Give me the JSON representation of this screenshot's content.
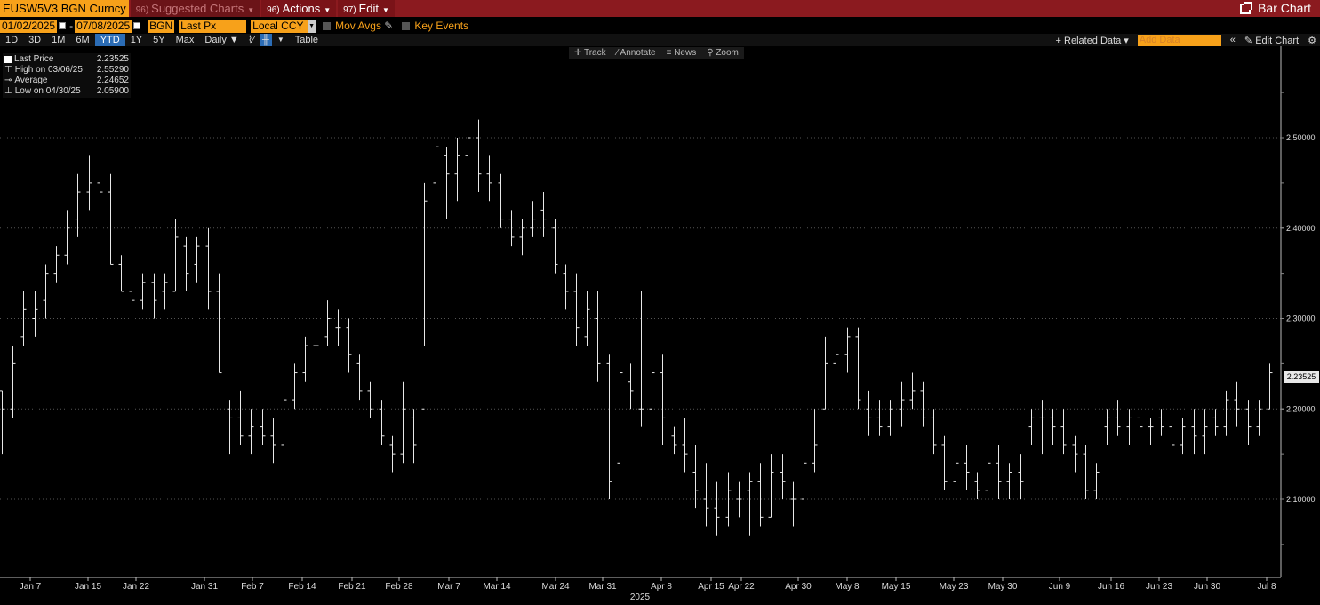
{
  "toolbar": {
    "ticker": "EUSW5V3 BGN Curncy",
    "menus": [
      {
        "num": "96)",
        "label": "Suggested Charts",
        "dim": true
      },
      {
        "num": "96)",
        "label": "Actions",
        "dim": false
      },
      {
        "num": "97)",
        "label": "Edit",
        "dim": false
      }
    ],
    "right_label": "Bar Chart"
  },
  "controls": {
    "start_date": "01/02/2025",
    "end_date": "07/08/2025",
    "source": "BGN",
    "field": "Last Px",
    "currency": "Local CCY",
    "mov_avgs": "Mov Avgs",
    "key_events": "Key Events"
  },
  "periods": [
    "1D",
    "3D",
    "1M",
    "6M",
    "YTD",
    "1Y",
    "5Y",
    "Max"
  ],
  "active_period": "YTD",
  "frequency": "Daily ▼",
  "table_label": "Table",
  "related_data": "+ Related Data ▾",
  "add_data_placeholder": "Add Data",
  "edit_chart": "Edit Chart",
  "chart_tools": [
    "Track",
    "Annotate",
    "News",
    "Zoom"
  ],
  "legend": [
    {
      "label": "Last Price",
      "value": "2.23525"
    },
    {
      "label": "High on 03/06/25",
      "value": "2.55290"
    },
    {
      "label": "Average",
      "value": "2.24652"
    },
    {
      "label": "Low on 04/30/25",
      "value": "2.05900"
    }
  ],
  "last_price_tag": "2.23525",
  "chart_data": {
    "type": "bar",
    "ylim": [
      2.0,
      2.56
    ],
    "y_ticks": [
      2.1,
      2.2,
      2.3,
      2.4,
      2.5
    ],
    "y_tick_labels": [
      "2.10000",
      "2.20000",
      "2.30000",
      "2.40000",
      "2.50000"
    ],
    "x_tick_labels": [
      "Jan 7",
      "Jan 15",
      "Jan 22",
      "Jan 31",
      "Feb 7",
      "Feb 14",
      "Feb 21",
      "Feb 28",
      "Mar 7",
      "Mar 14",
      "Mar 24",
      "Mar 31",
      "Apr 8",
      "Apr 15",
      "Apr 22",
      "Apr 30",
      "May 8",
      "May 15",
      "May 23",
      "May 30",
      "Jun 9",
      "Jun 16",
      "Jun 23",
      "Jun 30",
      "Jul 8"
    ],
    "year_label": "2025",
    "ohlc": [
      [
        2.22,
        2.22,
        2.15,
        2.2
      ],
      [
        2.2,
        2.27,
        2.19,
        2.25
      ],
      [
        2.28,
        2.33,
        2.27,
        2.31
      ],
      [
        2.3,
        2.33,
        2.28,
        2.31
      ],
      [
        2.32,
        2.36,
        2.3,
        2.35
      ],
      [
        2.35,
        2.38,
        2.34,
        2.37
      ],
      [
        2.37,
        2.42,
        2.36,
        2.4
      ],
      [
        2.41,
        2.46,
        2.39,
        2.44
      ],
      [
        2.44,
        2.48,
        2.42,
        2.45
      ],
      [
        2.45,
        2.47,
        2.41,
        2.44
      ],
      [
        2.44,
        2.46,
        2.36,
        2.36
      ],
      [
        2.36,
        2.37,
        2.33,
        2.33
      ],
      [
        2.33,
        2.34,
        2.31,
        2.32
      ],
      [
        2.32,
        2.35,
        2.31,
        2.34
      ],
      [
        2.34,
        2.35,
        2.3,
        2.32
      ],
      [
        2.33,
        2.35,
        2.31,
        2.34
      ],
      [
        2.33,
        2.41,
        2.33,
        2.39
      ],
      [
        2.38,
        2.39,
        2.33,
        2.35
      ],
      [
        2.36,
        2.39,
        2.34,
        2.38
      ],
      [
        2.38,
        2.4,
        2.31,
        2.33
      ],
      [
        2.33,
        2.35,
        2.24,
        2.24
      ],
      [
        2.2,
        2.21,
        2.15,
        2.19
      ],
      [
        2.19,
        2.22,
        2.16,
        2.17
      ],
      [
        2.17,
        2.2,
        2.15,
        2.18
      ],
      [
        2.18,
        2.2,
        2.16,
        2.17
      ],
      [
        2.17,
        2.19,
        2.14,
        2.16
      ],
      [
        2.16,
        2.22,
        2.16,
        2.21
      ],
      [
        2.21,
        2.25,
        2.2,
        2.24
      ],
      [
        2.24,
        2.28,
        2.23,
        2.27
      ],
      [
        2.27,
        2.29,
        2.26,
        2.27
      ],
      [
        2.28,
        2.32,
        2.27,
        2.3
      ],
      [
        2.29,
        2.31,
        2.27,
        2.29
      ],
      [
        2.29,
        2.3,
        2.24,
        2.26
      ],
      [
        2.25,
        2.26,
        2.21,
        2.22
      ],
      [
        2.22,
        2.23,
        2.19,
        2.2
      ],
      [
        2.2,
        2.21,
        2.16,
        2.17
      ],
      [
        2.16,
        2.17,
        2.13,
        2.15
      ],
      [
        2.15,
        2.23,
        2.14,
        2.2
      ],
      [
        2.19,
        2.2,
        2.14,
        2.16
      ],
      [
        2.2,
        2.45,
        2.27,
        2.43
      ],
      [
        2.45,
        2.55,
        2.42,
        2.49
      ],
      [
        2.48,
        2.49,
        2.41,
        2.46
      ],
      [
        2.46,
        2.5,
        2.43,
        2.48
      ],
      [
        2.48,
        2.52,
        2.47,
        2.5
      ],
      [
        2.5,
        2.52,
        2.44,
        2.46
      ],
      [
        2.46,
        2.48,
        2.43,
        2.45
      ],
      [
        2.45,
        2.46,
        2.4,
        2.41
      ],
      [
        2.41,
        2.42,
        2.38,
        2.39
      ],
      [
        2.39,
        2.41,
        2.37,
        2.4
      ],
      [
        2.4,
        2.43,
        2.39,
        2.41
      ],
      [
        2.42,
        2.44,
        2.39,
        2.41
      ],
      [
        2.4,
        2.41,
        2.35,
        2.36
      ],
      [
        2.35,
        2.36,
        2.31,
        2.33
      ],
      [
        2.33,
        2.35,
        2.27,
        2.29
      ],
      [
        2.28,
        2.33,
        2.27,
        2.31
      ],
      [
        2.3,
        2.33,
        2.23,
        2.25
      ],
      [
        2.25,
        2.26,
        2.1,
        2.12
      ],
      [
        2.14,
        2.3,
        2.12,
        2.24
      ],
      [
        2.23,
        2.25,
        2.2,
        2.22
      ],
      [
        2.2,
        2.33,
        2.18,
        2.2
      ],
      [
        2.2,
        2.26,
        2.17,
        2.24
      ],
      [
        2.24,
        2.26,
        2.16,
        2.19
      ],
      [
        2.17,
        2.18,
        2.15,
        2.16
      ],
      [
        2.16,
        2.19,
        2.13,
        2.15
      ],
      [
        2.13,
        2.16,
        2.09,
        2.11
      ],
      [
        2.1,
        2.14,
        2.07,
        2.09
      ],
      [
        2.09,
        2.12,
        2.06,
        2.08
      ],
      [
        2.08,
        2.13,
        2.07,
        2.11
      ],
      [
        2.1,
        2.12,
        2.08,
        2.1
      ],
      [
        2.11,
        2.13,
        2.06,
        2.12
      ],
      [
        2.12,
        2.14,
        2.07,
        2.08
      ],
      [
        2.08,
        2.15,
        2.08,
        2.13
      ],
      [
        2.13,
        2.15,
        2.1,
        2.12
      ],
      [
        2.1,
        2.12,
        2.07,
        2.1
      ],
      [
        2.1,
        2.15,
        2.08,
        2.14
      ],
      [
        2.14,
        2.2,
        2.13,
        2.16
      ],
      [
        2.2,
        2.28,
        2.2,
        2.25
      ],
      [
        2.25,
        2.27,
        2.24,
        2.26
      ],
      [
        2.26,
        2.29,
        2.24,
        2.28
      ],
      [
        2.28,
        2.29,
        2.2,
        2.21
      ],
      [
        2.2,
        2.22,
        2.17,
        2.19
      ],
      [
        2.19,
        2.21,
        2.17,
        2.18
      ],
      [
        2.18,
        2.21,
        2.17,
        2.2
      ],
      [
        2.2,
        2.23,
        2.18,
        2.21
      ],
      [
        2.21,
        2.24,
        2.2,
        2.22
      ],
      [
        2.22,
        2.23,
        2.18,
        2.19
      ],
      [
        2.19,
        2.2,
        2.15,
        2.16
      ],
      [
        2.16,
        2.17,
        2.11,
        2.12
      ],
      [
        2.12,
        2.15,
        2.11,
        2.14
      ],
      [
        2.14,
        2.16,
        2.11,
        2.13
      ],
      [
        2.12,
        2.13,
        2.1,
        2.11
      ],
      [
        2.11,
        2.15,
        2.1,
        2.14
      ],
      [
        2.14,
        2.16,
        2.1,
        2.12
      ],
      [
        2.12,
        2.14,
        2.1,
        2.13
      ],
      [
        2.13,
        2.15,
        2.1,
        2.12
      ],
      [
        2.18,
        2.2,
        2.16,
        2.19
      ],
      [
        2.19,
        2.21,
        2.15,
        2.19
      ],
      [
        2.19,
        2.2,
        2.16,
        2.18
      ],
      [
        2.18,
        2.2,
        2.15,
        2.16
      ],
      [
        2.16,
        2.17,
        2.13,
        2.15
      ],
      [
        2.15,
        2.16,
        2.1,
        2.11
      ],
      [
        2.11,
        2.14,
        2.1,
        2.13
      ],
      [
        2.18,
        2.2,
        2.16,
        2.19
      ],
      [
        2.19,
        2.21,
        2.17,
        2.18
      ],
      [
        2.18,
        2.2,
        2.16,
        2.19
      ],
      [
        2.19,
        2.2,
        2.17,
        2.18
      ],
      [
        2.18,
        2.19,
        2.16,
        2.18
      ],
      [
        2.19,
        2.2,
        2.17,
        2.18
      ],
      [
        2.18,
        2.19,
        2.15,
        2.16
      ],
      [
        2.16,
        2.19,
        2.15,
        2.18
      ],
      [
        2.18,
        2.2,
        2.15,
        2.17
      ],
      [
        2.17,
        2.2,
        2.15,
        2.18
      ],
      [
        2.19,
        2.2,
        2.17,
        2.18
      ],
      [
        2.18,
        2.22,
        2.17,
        2.21
      ],
      [
        2.21,
        2.23,
        2.18,
        2.2
      ],
      [
        2.2,
        2.21,
        2.16,
        2.18
      ],
      [
        2.18,
        2.21,
        2.17,
        2.2
      ],
      [
        2.2,
        2.25,
        2.2,
        2.24
      ]
    ]
  }
}
